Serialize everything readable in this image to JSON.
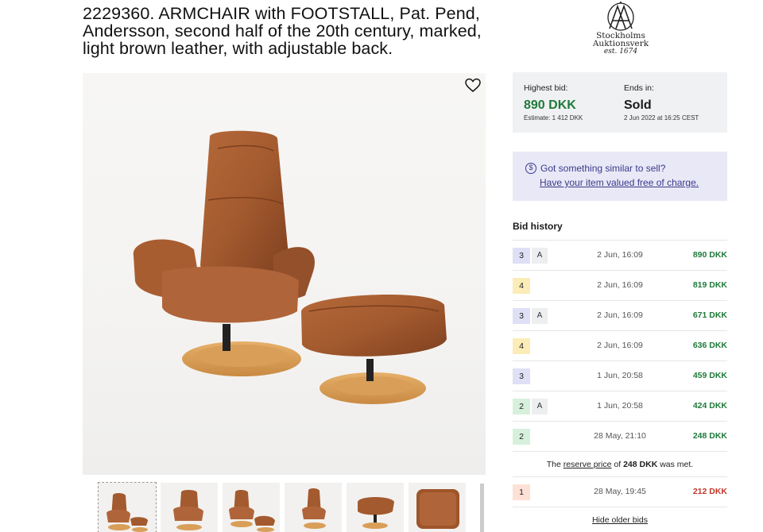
{
  "lot": {
    "title": "2229360. ARMCHAIR with FOOTSTALL, Pat. Pend, Andersson, second half of the 20th century, marked, light brown leather, with adjustable back."
  },
  "logo": {
    "line1": "Stockholms",
    "line2": "Auktionsverk",
    "line3": "est. 1674"
  },
  "bid_summary": {
    "highest_label": "Highest bid:",
    "highest_value": "890 DKK",
    "estimate": "Estimate: 1 412 DKK",
    "ends_label": "Ends in:",
    "ends_value": "Sold",
    "ends_date": "2 Jun 2022 at 16:25 CEST"
  },
  "sell_banner": {
    "text": "Got something similar to sell?",
    "link": "Have your item valued free of charge."
  },
  "bid_history": {
    "title": "Bid history",
    "rows": [
      {
        "bidder": "3",
        "auto": "A",
        "time": "2 Jun, 16:09",
        "amount": "890 DKK"
      },
      {
        "bidder": "4",
        "auto": "",
        "time": "2 Jun, 16:09",
        "amount": "819 DKK"
      },
      {
        "bidder": "3",
        "auto": "A",
        "time": "2 Jun, 16:09",
        "amount": "671 DKK"
      },
      {
        "bidder": "4",
        "auto": "",
        "time": "2 Jun, 16:09",
        "amount": "636 DKK"
      },
      {
        "bidder": "3",
        "auto": "",
        "time": "1 Jun, 20:58",
        "amount": "459 DKK"
      },
      {
        "bidder": "2",
        "auto": "A",
        "time": "1 Jun, 20:58",
        "amount": "424 DKK"
      },
      {
        "bidder": "2",
        "auto": "",
        "time": "28 May, 21:10",
        "amount": "248 DKK"
      }
    ],
    "reserve": {
      "pre": "The",
      "link": "reserve price",
      "mid": "of",
      "amount": "248 DKK",
      "post": "was met."
    },
    "below_reserve": {
      "bidder": "1",
      "time": "28 May, 19:45",
      "amount": "212 DKK"
    },
    "hide_older": "Hide older bids"
  },
  "colors": {
    "green": "#1f7a3a",
    "red": "#c0392b",
    "bidder_3": "#dfe0f5",
    "bidder_4": "#fbecb8",
    "bidder_2": "#d7f0dc",
    "bidder_1": "#fde0d6"
  }
}
